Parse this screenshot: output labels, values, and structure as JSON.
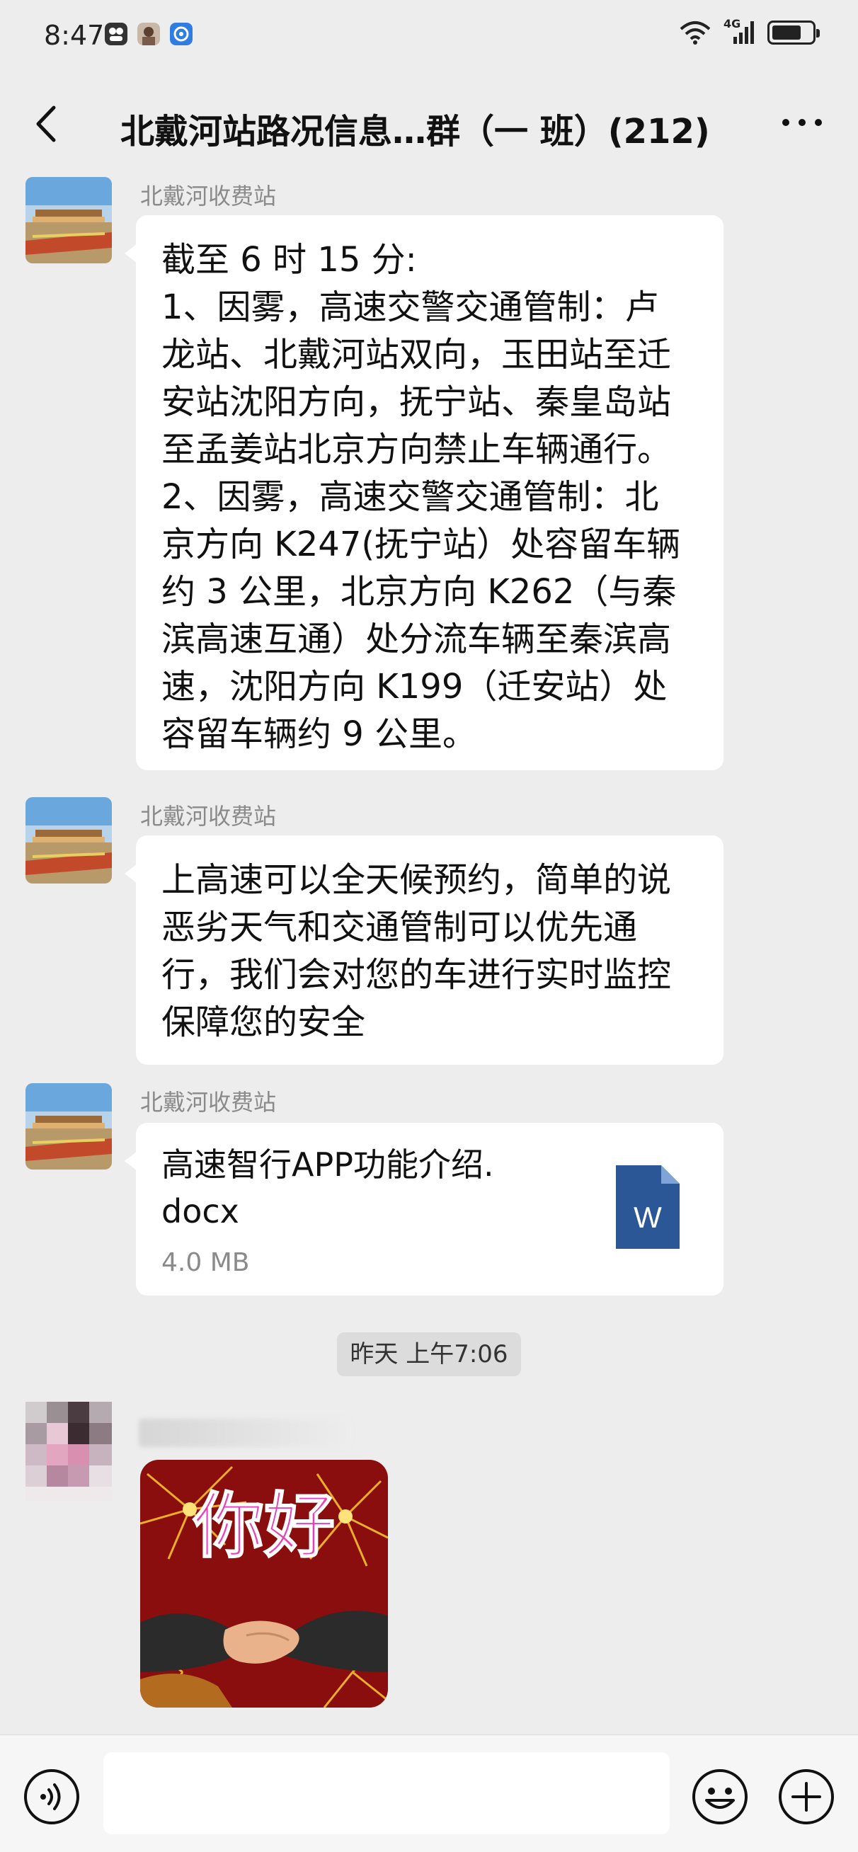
{
  "status_bar": {
    "time": "8:47",
    "network": "4G",
    "icons": [
      "app-icon-1",
      "app-icon-2",
      "app-icon-3",
      "wifi-icon",
      "signal-icon",
      "battery-icon"
    ]
  },
  "header": {
    "title": "北戴河站路况信息…群（一 班）(212)",
    "back_icon": "chevron-left-icon",
    "more_icon": "more-dots-icon"
  },
  "messages": [
    {
      "sender": "北戴河收费站",
      "type": "text",
      "lines": [
        "截至 6 时 15 分:",
        "1、因雾，高速交警交通管制：卢",
        "龙站、北戴河站双向，玉田站至迁",
        "安站沈阳方向，抚宁站、秦皇岛站",
        "至孟姜站北京方向禁止车辆通行。",
        "2、因雾，高速交警交通管制：北",
        "京方向 K247(抚宁站）处容留车辆",
        "约 3 公里，北京方向 K262（与秦",
        "滨高速互通）处分流车辆至秦滨高",
        "速，沈阳方向 K199（迁安站）处",
        "容留车辆约 9 公里。"
      ]
    },
    {
      "sender": "北戴河收费站",
      "type": "text",
      "lines": [
        "上高速可以全天候预约，简单的说",
        "恶劣天气和交通管制可以优先通",
        "行，我们会对您的车进行实时监控",
        "保障您的安全"
      ]
    },
    {
      "sender": "北戴河收费站",
      "type": "file",
      "file_name": "高速智行APP功能介绍.docx",
      "file_name_line1": "高速智行APP功能介绍.",
      "file_name_line2": "docx",
      "file_size": "4.0 MB",
      "file_icon_letter": "W"
    }
  ],
  "timestamp": "昨天 上午7:06",
  "sticker_message": {
    "sticker_text": "你好"
  },
  "input_bar": {
    "placeholder": "",
    "voice_icon": "voice-icon",
    "emoji_icon": "emoji-icon",
    "plus_icon": "plus-icon"
  },
  "colors": {
    "background": "#ededed",
    "bubble": "#ffffff",
    "word_blue": "#2b5797",
    "sender_gray": "#8a8a8a"
  }
}
